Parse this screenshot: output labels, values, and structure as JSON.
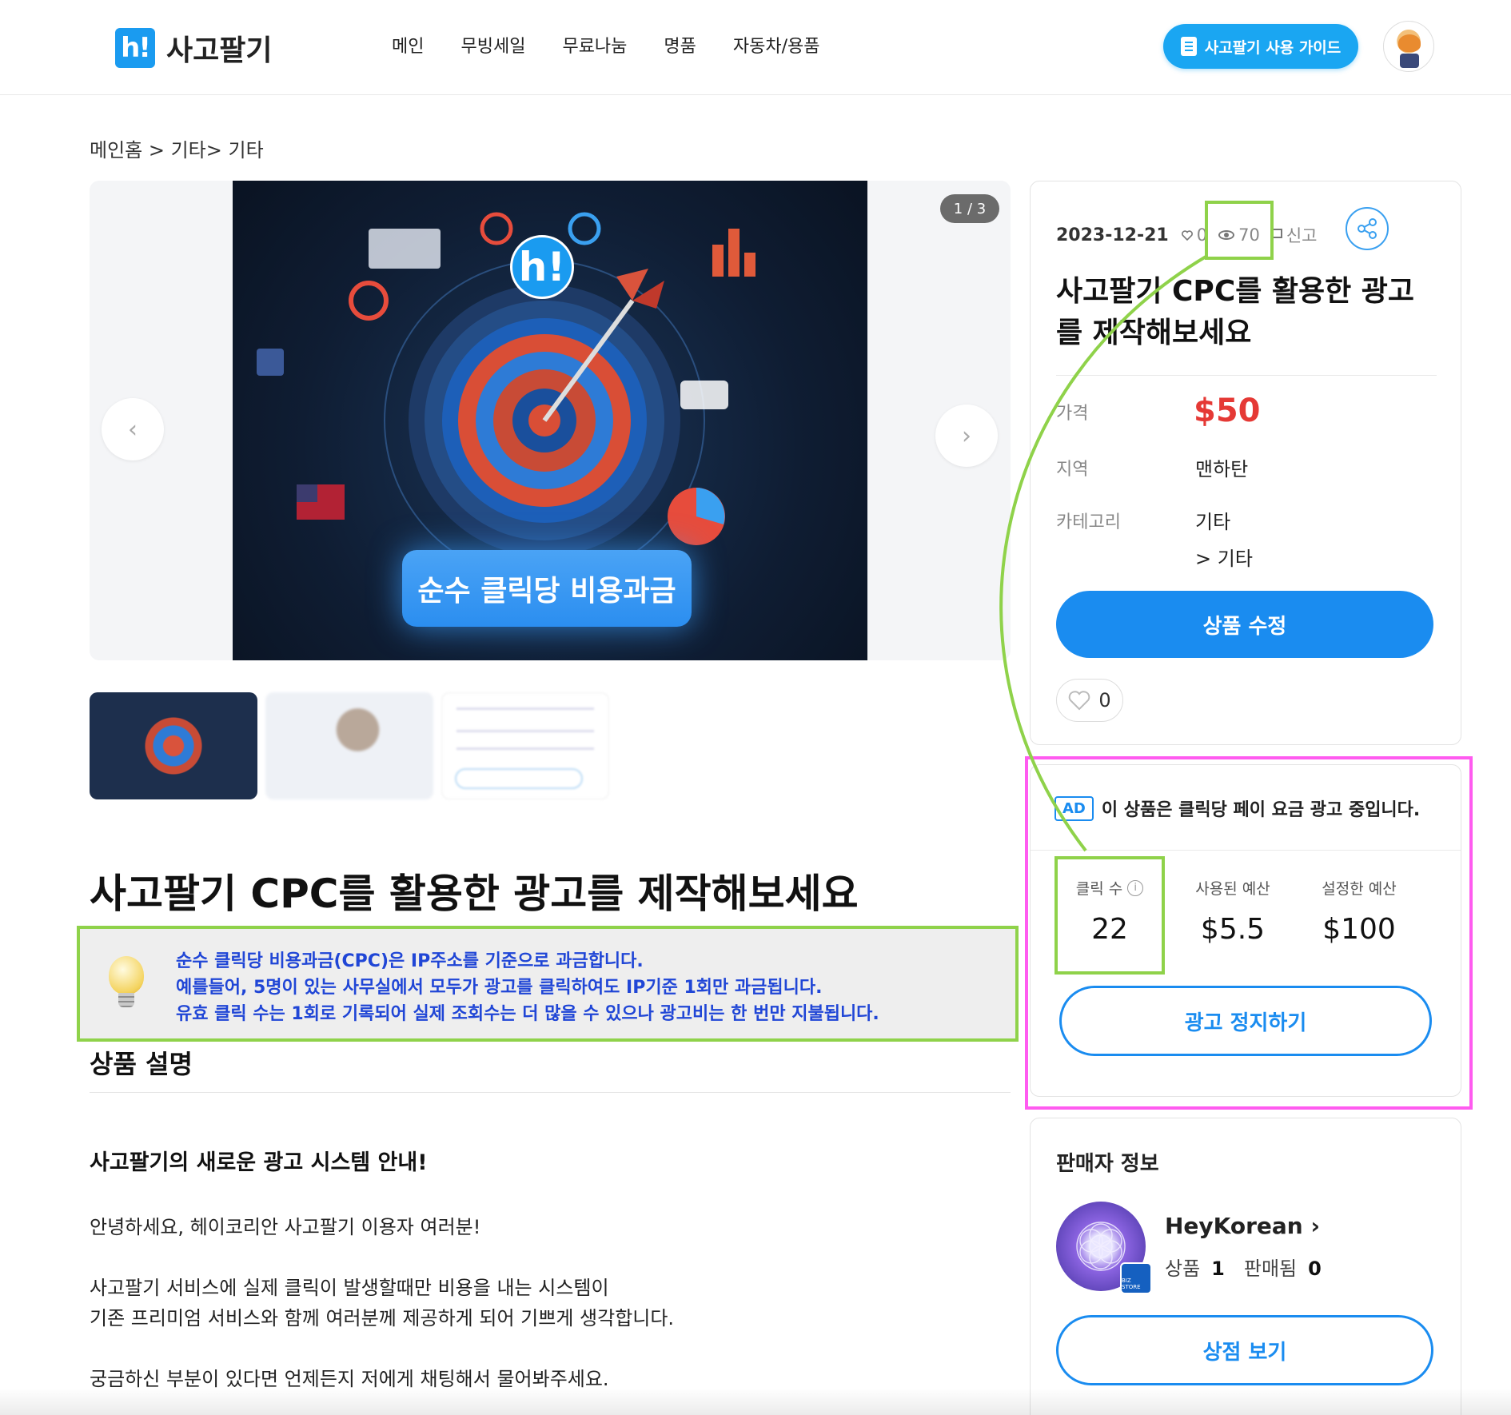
{
  "header": {
    "logo_mark": "h!",
    "logo_text": "사고팔기",
    "nav": [
      "메인",
      "무빙세일",
      "무료나눔",
      "명품",
      "자동차/용품"
    ],
    "guide_button": "사고팔기 사용 가이드"
  },
  "breadcrumb": "메인홈 > 기타> 기타",
  "gallery": {
    "counter": "1 / 3",
    "image_logo": "h!",
    "image_caption": "순수 클릭당 비용과금"
  },
  "product_title": "사고팔기 CPC를 활용한 광고를 제작해보세요",
  "notice_lines": [
    "순수 클릭당 비용과금(CPC)은 IP주소를 기준으로 과금합니다.",
    "예를들어, 5명이 있는 사무실에서 모두가 광고를 클릭하여도 IP기준 1회만 과금됩니다.",
    "유효 클릭 수는 1회로 기록되어 실제 조회수는 더 많을 수 있으나 광고비는 한 번만 지불됩니다."
  ],
  "description": {
    "title": "상품 설명",
    "subtitle": "사고팔기의 새로운 광고 시스템 안내!",
    "p1": "안녕하세요, 헤이코리안 사고팔기 이용자 여러분!",
    "p2a": "사고팔기 서비스에 실제 클릭이 발생할때만 비용을 내는 시스템이",
    "p2b": "기존 프리미엄 서비스와 함께 여러분께 제공하게 되어 기쁘게 생각합니다.",
    "p3": "궁금하신 부분이 있다면 언제든지 저에게 채팅해서 물어봐주세요."
  },
  "info_card": {
    "date": "2023-12-21",
    "likes": "0",
    "views": "70",
    "report": "신고",
    "title": "사고팔기 CPC를 활용한 광고를 제작해보세요",
    "price_label": "가격",
    "price": "$50",
    "region_label": "지역",
    "region": "맨하탄",
    "category_label": "카테고리",
    "category_1": "기타",
    "category_2": "> 기타",
    "edit_button": "상품 수정",
    "like_count": "0"
  },
  "ad_card": {
    "badge": "AD",
    "text": "이 상품은 클릭당 페이 요금 광고 중입니다.",
    "clicks_label": "클릭 수",
    "clicks": "22",
    "spent_label": "사용된 예산",
    "spent": "$5.5",
    "budget_label": "설정한 예산",
    "budget": "$100",
    "stop_button": "광고 정지하기"
  },
  "seller": {
    "title": "판매자 정보",
    "name": "HeyKorean",
    "items_label": "상품",
    "items": "1",
    "sold_label": "판매됨",
    "sold": "0",
    "badge": "BIZ STORE",
    "store_button": "상점 보기"
  },
  "colors": {
    "brand_blue": "#1a8cf0",
    "price_red": "#e53935",
    "highlight_green": "#8fd24a",
    "highlight_magenta": "#ff5bf0",
    "notice_text": "#2046d6"
  }
}
